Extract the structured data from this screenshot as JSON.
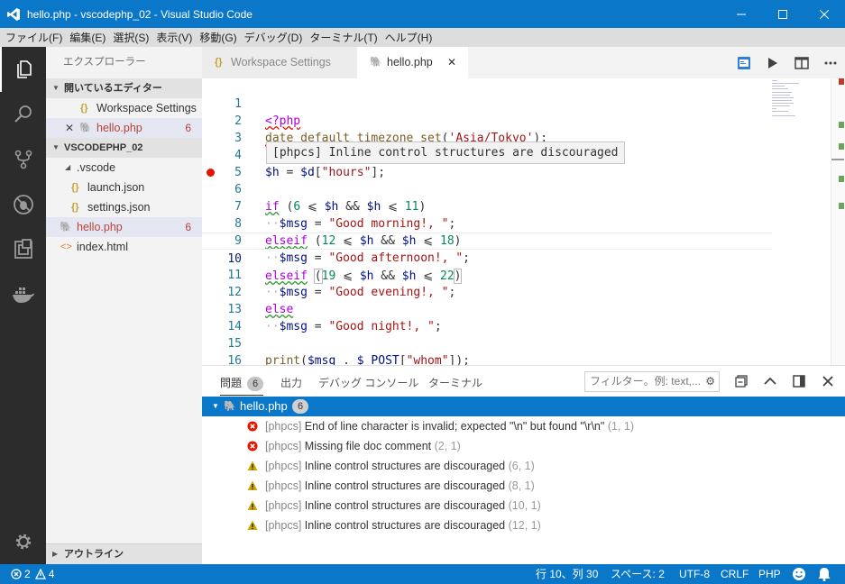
{
  "window": {
    "title": "hello.php - vscodephp_02 - Visual Studio Code",
    "minimize": "—",
    "maximize": "☐",
    "close": "✕"
  },
  "menu": [
    "ファイル(F)",
    "編集(E)",
    "選択(S)",
    "表示(V)",
    "移動(G)",
    "デバッグ(D)",
    "ターミナル(T)",
    "ヘルプ(H)"
  ],
  "sidebar": {
    "title": "エクスプローラー",
    "open_editors_header": "開いているエディター",
    "open_editors": [
      {
        "label": "Workspace Settings",
        "icon": "json-icon",
        "badge": ""
      },
      {
        "label": "hello.php",
        "icon": "php-icon",
        "badge": "6"
      }
    ],
    "project_header": "VSCODEPHP_02",
    "tree": [
      {
        "label": ".vscode",
        "icon": "folder-chevron-icon"
      },
      {
        "label": "launch.json",
        "icon": "json-icon"
      },
      {
        "label": "settings.json",
        "icon": "json-icon"
      },
      {
        "label": "hello.php",
        "icon": "php-icon",
        "badge": "6"
      },
      {
        "label": "index.html",
        "icon": "html-icon"
      }
    ],
    "outline_header": "アウトライン"
  },
  "tabs": [
    {
      "label": "Workspace Settings",
      "active": false
    },
    {
      "label": "hello.php",
      "active": true
    }
  ],
  "editor": {
    "hover_text": "[phpcs] Inline control structures are discouraged",
    "current_line": 10,
    "line_numbers": [
      "1",
      "2",
      "3",
      "4",
      "5",
      "6",
      "7",
      "8",
      "9",
      "10",
      "11",
      "12",
      "13",
      "14",
      "15",
      "16"
    ]
  },
  "panel": {
    "tabs": [
      {
        "label": "問題",
        "count": "6"
      },
      {
        "label": "出力"
      },
      {
        "label": "デバッグ コンソール"
      },
      {
        "label": "ターミナル"
      }
    ],
    "filter_placeholder": "フィルター。例: text,...",
    "file": {
      "name": "hello.php",
      "count": "6"
    },
    "problems": [
      {
        "severity": "error",
        "source": "[phpcs]",
        "message": "End of line character is invalid; expected \"\\n\" but found \"\\r\\n\"",
        "position": "(1, 1)"
      },
      {
        "severity": "error",
        "source": "[phpcs]",
        "message": "Missing file doc comment",
        "position": "(2, 1)"
      },
      {
        "severity": "warning",
        "source": "[phpcs]",
        "message": "Inline control structures are discouraged",
        "position": "(6, 1)"
      },
      {
        "severity": "warning",
        "source": "[phpcs]",
        "message": "Inline control structures are discouraged",
        "position": "(8, 1)"
      },
      {
        "severity": "warning",
        "source": "[phpcs]",
        "message": "Inline control structures are discouraged",
        "position": "(10, 1)"
      },
      {
        "severity": "warning",
        "source": "[phpcs]",
        "message": "Inline control structures are discouraged",
        "position": "(12, 1)"
      }
    ]
  },
  "status": {
    "errors": "2",
    "warnings": "4",
    "cursor": "行 10、列 30",
    "spaces": "スペース: 2",
    "encoding": "UTF-8",
    "eol": "CRLF",
    "language": "PHP"
  },
  "colors": {
    "accent": "#0b77c8",
    "error": "#e51400",
    "warning": "#cca700"
  }
}
